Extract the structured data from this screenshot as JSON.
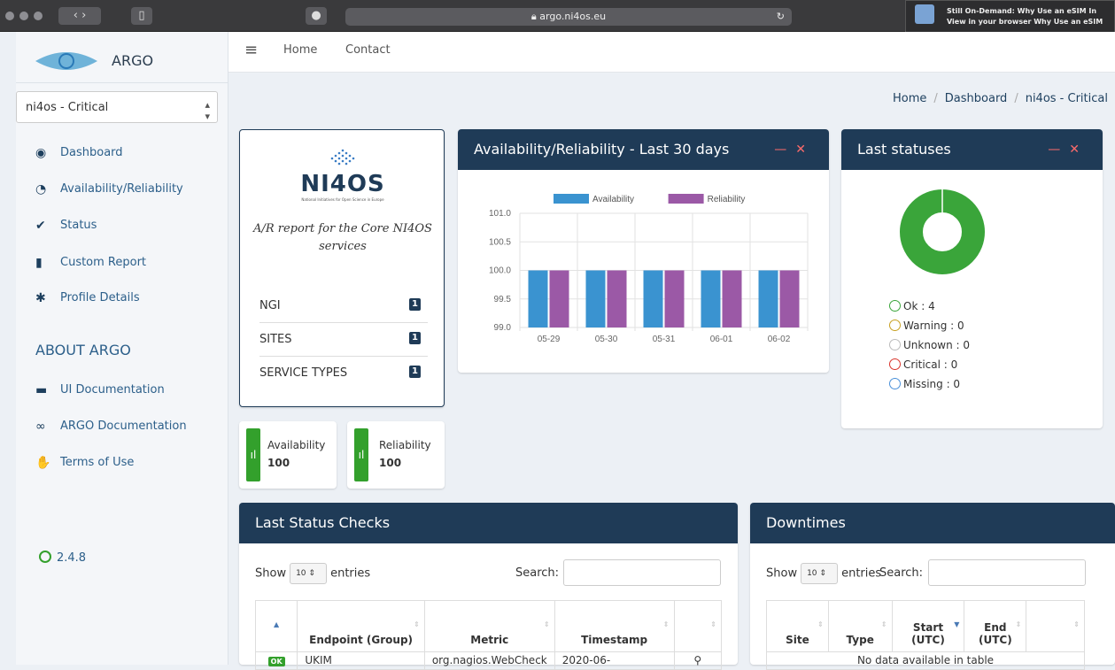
{
  "browser": {
    "url": "argo.ni4os.eu",
    "notification_line1": "Still On-Demand: Why Use an eSIM In",
    "notification_line2": "View in your browser Why Use an eSIM"
  },
  "sidebar": {
    "logo_text": "ARGO",
    "profile": "ni4os - Critical",
    "items": [
      {
        "label": "Dashboard",
        "icon": "eye-icon"
      },
      {
        "label": "Availability/Reliability",
        "icon": "gauge-icon"
      },
      {
        "label": "Status",
        "icon": "check-circle-icon"
      },
      {
        "label": "Custom Report",
        "icon": "file-icon"
      },
      {
        "label": "Profile Details",
        "icon": "gear-icon"
      }
    ],
    "about_title": "ABOUT ARGO",
    "about_items": [
      {
        "label": "UI Documentation",
        "icon": "book-icon"
      },
      {
        "label": "ARGO Documentation",
        "icon": "link-icon"
      },
      {
        "label": "Terms of Use",
        "icon": "handshake-icon"
      }
    ],
    "version": "2.4.8"
  },
  "topnav": {
    "home": "Home",
    "contact": "Contact"
  },
  "breadcrumb": {
    "home": "Home",
    "dashboard": "Dashboard",
    "current": "ni4os - Critical"
  },
  "info_card": {
    "logo": "NI4OS",
    "logo_sub": "National Initiatives for Open Science in Europe",
    "description": "A/R report for the Core NI4OS services",
    "rows": [
      {
        "label": "NGI",
        "count": "1"
      },
      {
        "label": "SITES",
        "count": "1"
      },
      {
        "label": "SERVICE TYPES",
        "count": "1"
      }
    ]
  },
  "kpis": {
    "availability_label": "Availability",
    "availability_value": "100",
    "reliability_label": "Reliability",
    "reliability_value": "100"
  },
  "chart_panel": {
    "title": "Availability/Reliability - Last 30 days"
  },
  "chart_data": {
    "type": "bar",
    "categories": [
      "05-29",
      "05-30",
      "05-31",
      "06-01",
      "06-02"
    ],
    "series": [
      {
        "name": "Availability",
        "values": [
          100,
          100,
          100,
          100,
          100
        ],
        "color": "#3a93d0"
      },
      {
        "name": "Reliability",
        "values": [
          100,
          100,
          100,
          100,
          100
        ],
        "color": "#9b59a6"
      }
    ],
    "ylim": [
      99.0,
      101.0
    ],
    "yticks": [
      "101.0",
      "100.5",
      "100.0",
      "99.5",
      "99.0"
    ],
    "legend": "top",
    "grid": true
  },
  "statuses": {
    "title": "Last statuses",
    "ok_value": 4,
    "ok_color": "#3aa53a",
    "legend": [
      {
        "label": "Ok : 4",
        "color": "#3aa53a"
      },
      {
        "label": "Warning : 0",
        "color": "#c8a020"
      },
      {
        "label": "Unknown : 0",
        "color": "#bbbbbb"
      },
      {
        "label": "Critical : 0",
        "color": "#d9342b"
      },
      {
        "label": "Missing : 0",
        "color": "#4a90d9"
      }
    ]
  },
  "checks": {
    "title": "Last Status Checks",
    "show": "Show",
    "entries": "entries",
    "page_size": "10",
    "search": "Search:",
    "columns": [
      "Endpoint (Group)",
      "Metric",
      "Timestamp"
    ],
    "row": {
      "status": "OK",
      "endpoint": "UKIM",
      "metric": "org.nagios.WebCheck",
      "timestamp": "2020-06-"
    }
  },
  "downtimes": {
    "title": "Downtimes",
    "show": "Show",
    "entries": "entries",
    "page_size": "10",
    "search": "Search:",
    "columns": [
      "Site",
      "Type",
      "Start (UTC)",
      "End (UTC)"
    ],
    "empty": "No data available in table"
  }
}
